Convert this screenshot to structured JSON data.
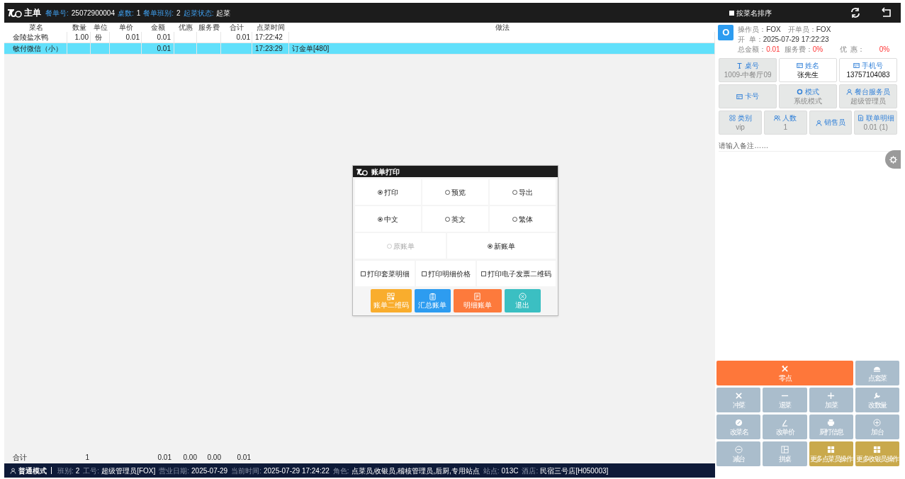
{
  "header": {
    "title": "主单",
    "fields": [
      {
        "label": "餐单号:",
        "value": "25072900004"
      },
      {
        "label": "桌数:",
        "value": "1"
      },
      {
        "label": "餐单班别:",
        "value": "2"
      },
      {
        "label": "起菜状态:",
        "value": "起菜"
      }
    ],
    "sort_option": {
      "label": "按菜名排序",
      "checked": false
    }
  },
  "table": {
    "columns": [
      "菜名",
      "数量",
      "单位",
      "单价",
      "金额",
      "优惠",
      "服务费",
      "合计",
      "点菜时间",
      "做法"
    ],
    "rows": [
      {
        "selected": false,
        "cells": {
          "column_1": "金陵盐水鸭",
          "column_2": "1.00",
          "column_3": "份",
          "column_4": "0.01",
          "column_5": "0.01",
          "column_8": "0.01",
          "column_9": "17:22:42"
        }
      },
      {
        "selected": true,
        "cells": {
          "column_1": "敏付微信（小）",
          "column_5": "0.01",
          "column_9": "17:23:29",
          "column_10": "订金单[480]"
        }
      }
    ],
    "totals": {
      "column_1": "合计",
      "column_2": "1",
      "column_5": "0.01",
      "column_6": "0.00",
      "column_7": "0.00",
      "column_8": "0.01"
    }
  },
  "order_info": {
    "avatar": "O",
    "operator_label": "操作员：",
    "operator": "FOX",
    "opener_label": "开单员：",
    "opener": "FOX",
    "open_label": "开  单：",
    "open_time": "2025-07-29 17:22:23",
    "total_label": "总金额：",
    "total": "0.01",
    "service_label": "服务费：",
    "service": "0%",
    "discount_label": "优  惠：",
    "discount": "0%"
  },
  "info_cards": [
    {
      "label": "桌号",
      "value": "1009-中餐厅09",
      "editable": false
    },
    {
      "label": "姓名",
      "value": "张先生",
      "editable": true
    },
    {
      "label": "手机号",
      "value": "13757104083",
      "editable": true
    },
    {
      "label": "卡号",
      "editable": false
    },
    {
      "label": "模式",
      "value": "系统模式",
      "editable": false
    },
    {
      "label": "餐台服务员",
      "value": "超级管理员",
      "editable": false
    },
    {
      "label": "类别",
      "value": "vip",
      "editable": false
    },
    {
      "label": "人数",
      "value": "1",
      "editable": false
    },
    {
      "label": "销售员",
      "editable": false
    },
    {
      "label": "联单明细",
      "value": "0.01 (1)",
      "editable": false
    }
  ],
  "remark": {
    "placeholder": "请输入备注……"
  },
  "actions": [
    {
      "label": "零点",
      "kind": "wide",
      "color": "#fe773a"
    },
    {
      "label": "点套菜",
      "kind": "normal",
      "color": "#aabdcc"
    },
    {
      "label": "冲菜",
      "kind": "normal",
      "color": "#aabdcc"
    },
    {
      "label": "退菜",
      "kind": "normal",
      "color": "#aabdcc"
    },
    {
      "label": "加菜",
      "kind": "normal",
      "color": "#aabdcc"
    },
    {
      "label": "改数量",
      "kind": "normal",
      "color": "#aabdcc"
    },
    {
      "label": "改菜名",
      "kind": "normal",
      "color": "#aabdcc"
    },
    {
      "label": "改单价",
      "kind": "normal",
      "color": "#aabdcc"
    },
    {
      "label": "厨打信息",
      "kind": "normal",
      "color": "#aabdcc"
    },
    {
      "label": "加台",
      "kind": "normal",
      "color": "#aabdcc"
    },
    {
      "label": "减台",
      "kind": "normal",
      "color": "#aabdcc"
    },
    {
      "label": "拼桌",
      "kind": "normal",
      "color": "#aabdcc"
    },
    {
      "label": "更多点菜员操作",
      "kind": "normal",
      "color": "#c9a94c"
    },
    {
      "label": "更多收银员操作",
      "kind": "normal",
      "color": "#c9a94c"
    }
  ],
  "status_bar": {
    "mode": "普通模式",
    "items": [
      {
        "label": "班别:",
        "value": "2"
      },
      {
        "label": "工号:",
        "value": "超级管理员[FOX]"
      },
      {
        "label": "营业日期:",
        "value": "2025-07-29"
      },
      {
        "label": "当前时间:",
        "value": "2025-07-29 17:24:22"
      },
      {
        "label": "角色:",
        "value": "点菜员,收银员,稽核管理员,后厨,专用站点"
      },
      {
        "label": "站点:",
        "value": "013C"
      },
      {
        "label": "酒店:",
        "value": "民宿三号店[H050003]"
      }
    ]
  },
  "dialog": {
    "title": "账单打印",
    "radio_groups": [
      [
        {
          "label": "打印",
          "selected": true,
          "disabled": false
        },
        {
          "label": "预览",
          "selected": false,
          "disabled": false
        },
        {
          "label": "导出",
          "selected": false,
          "disabled": false
        }
      ],
      [
        {
          "label": "中文",
          "selected": true,
          "disabled": false
        },
        {
          "label": "英文",
          "selected": false,
          "disabled": false
        },
        {
          "label": "繁体",
          "selected": false,
          "disabled": false
        }
      ],
      [
        {
          "label": "原账单",
          "selected": false,
          "disabled": true
        },
        {
          "label": "新账单",
          "selected": true,
          "disabled": false
        }
      ]
    ],
    "checkboxes": [
      {
        "label": "打印套菜明细",
        "checked": false
      },
      {
        "label": "打印明细价格",
        "checked": false
      },
      {
        "label": "打印电子发票二维码",
        "checked": false
      }
    ],
    "buttons": [
      {
        "label": "账单二维码",
        "color": "#f9ad2d"
      },
      {
        "label": "汇总账单",
        "color": "#2d9cf0"
      },
      {
        "label": "明细账单",
        "color": "#fd7a3c"
      },
      {
        "label": "退出",
        "color": "#3bbfc2"
      }
    ]
  }
}
